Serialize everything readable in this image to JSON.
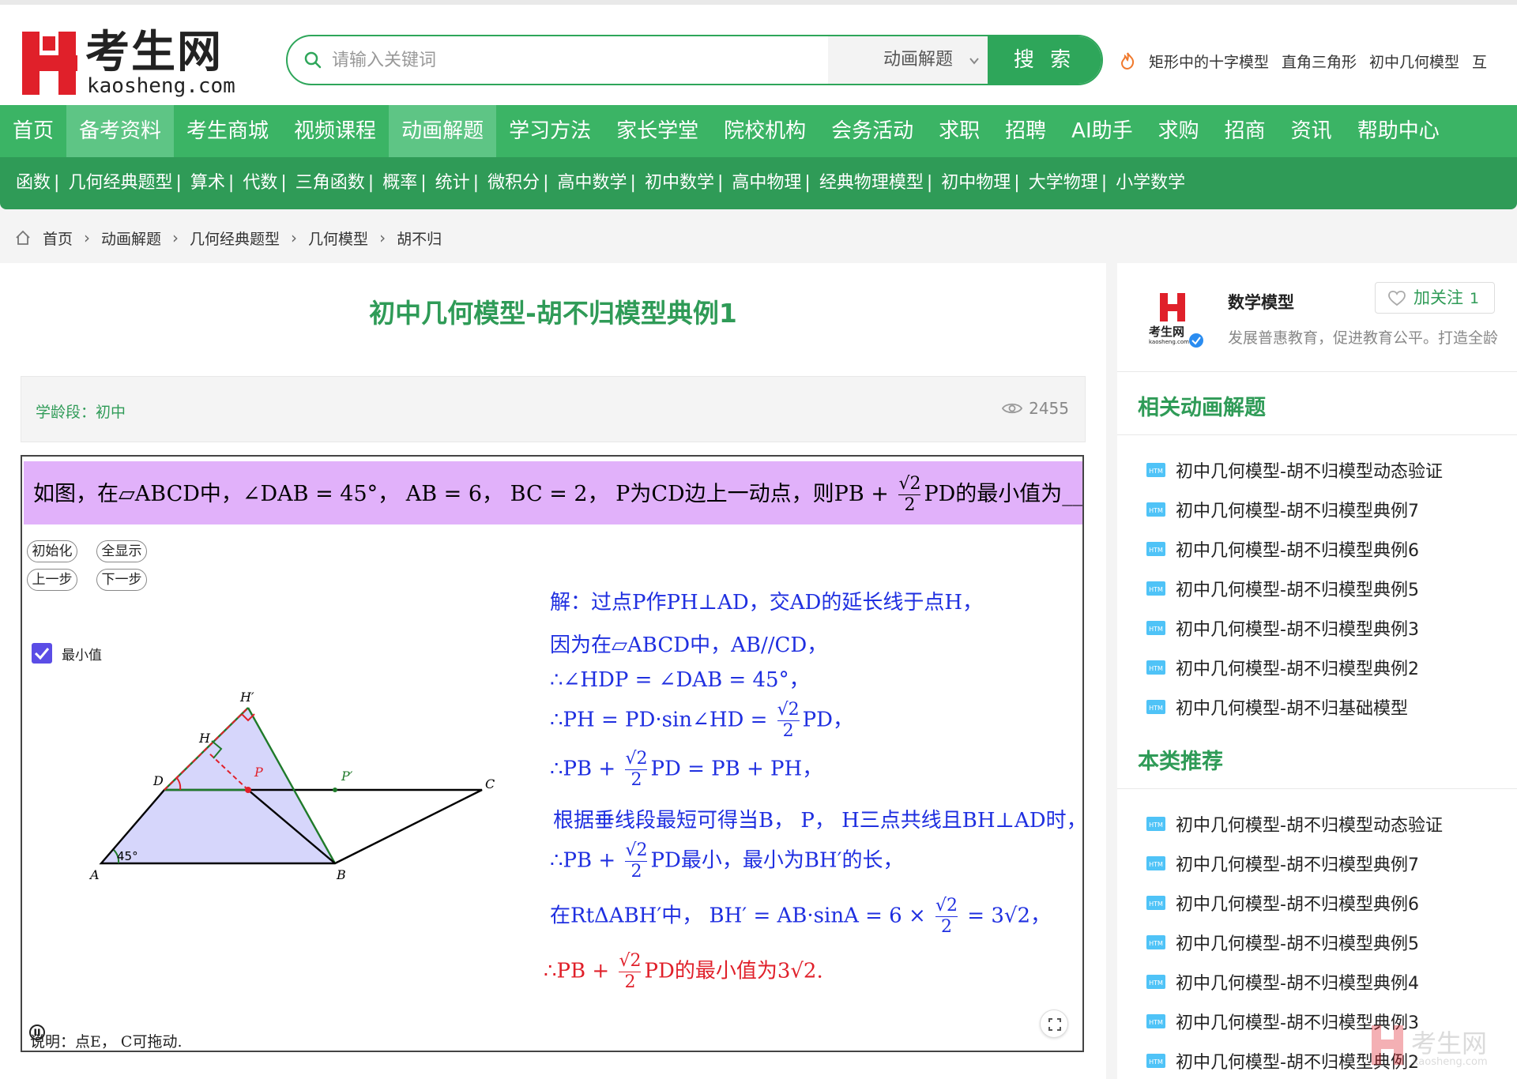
{
  "brand": {
    "cn": "考生网",
    "en": "kaosheng.com"
  },
  "search": {
    "placeholder": "请输入关键词",
    "category": "动画解题",
    "button": "搜 索"
  },
  "hot_keywords": [
    "矩形中的十字模型",
    "直角三角形",
    "初中几何模型",
    "互"
  ],
  "nav": [
    {
      "label": "首页",
      "active": false
    },
    {
      "label": "备考资料",
      "active": true
    },
    {
      "label": "考生商城",
      "active": false
    },
    {
      "label": "视频课程",
      "active": false
    },
    {
      "label": "动画解题",
      "active": true
    },
    {
      "label": "学习方法",
      "active": false
    },
    {
      "label": "家长学堂",
      "active": false
    },
    {
      "label": "院校机构",
      "active": false
    },
    {
      "label": "会务活动",
      "active": false
    },
    {
      "label": "求职",
      "active": false
    },
    {
      "label": "招聘",
      "active": false
    },
    {
      "label": "AI助手",
      "active": false
    },
    {
      "label": "求购",
      "active": false
    },
    {
      "label": "招商",
      "active": false
    },
    {
      "label": "资讯",
      "active": false
    },
    {
      "label": "帮助中心",
      "active": false
    }
  ],
  "subnav": [
    "函数",
    "几何经典题型",
    "算术",
    "代数",
    "三角函数",
    "概率",
    "统计",
    "微积分",
    "高中数学",
    "初中数学",
    "高中物理",
    "经典物理模型",
    "初中物理",
    "大学物理",
    "小学数学"
  ],
  "breadcrumb": [
    "首页",
    "动画解题",
    "几何经典题型",
    "几何模型",
    "胡不归"
  ],
  "article": {
    "title": "初中几何模型-胡不归模型典例1",
    "level": "学龄段：初中",
    "views": "2455"
  },
  "applet": {
    "question": "如图，在▱ABCD中，∠DAB = 45°， AB = 6， BC = 2， P为CD边上一动点，则PB + ",
    "question_tail": "PD的最小值为______",
    "buttons": {
      "init": "初始化",
      "show_all": "全显示",
      "prev": "上一步",
      "next": "下一步"
    },
    "checkbox_label": "最小值",
    "note": "说明：点E， C可拖动.",
    "points": {
      "A": "A",
      "B": "B",
      "C": "C",
      "D": "D",
      "P": "P",
      "P2": "P′",
      "H": "H",
      "H2": "H′",
      "angle": "45°"
    },
    "solution": [
      "解：过点P作PH⊥AD，交AD的延长线于点H，",
      "因为在▱ABCD中，AB//CD，",
      "∴∠HDP = ∠DAB = 45°，",
      "∴PH = PD·sin∠HD = ",
      "PD，",
      "∴PB + ",
      "PD = PB + PH，",
      "根据垂线段最短可得当B， P， H三点共线且BH⊥AD时，",
      "∴PB + ",
      "PD最小，最小为BH′的长，",
      "在RtΔABH′中， BH′ = AB·sinA = 6 × ",
      " = 3√2，",
      "∴PB + ",
      "PD的最小值为3√2."
    ],
    "frac_num": "√2",
    "frac_den": "2"
  },
  "author": {
    "name": "数学模型",
    "desc": "发展普惠教育，促进教育公平。打造全龄",
    "follow": "加关注",
    "follow_count": "1"
  },
  "related": {
    "title": "相关动画解题",
    "items": [
      "初中几何模型-胡不归模型动态验证",
      "初中几何模型-胡不归模型典例7",
      "初中几何模型-胡不归模型典例6",
      "初中几何模型-胡不归模型典例5",
      "初中几何模型-胡不归模型典例3",
      "初中几何模型-胡不归模型典例2",
      "初中几何模型-胡不归基础模型"
    ]
  },
  "recommend": {
    "title": "本类推荐",
    "items": [
      "初中几何模型-胡不归模型动态验证",
      "初中几何模型-胡不归模型典例7",
      "初中几何模型-胡不归模型典例6",
      "初中几何模型-胡不归模型典例5",
      "初中几何模型-胡不归模型典例4",
      "初中几何模型-胡不归模型典例3",
      "初中几何模型-胡不归模型典例2"
    ]
  },
  "colors": {
    "green": "#3bb465",
    "dark_green": "#2f9b57",
    "question_bg": "#e1b1fa",
    "solution_blue": "#1f2fe0",
    "answer_red": "#e0202a"
  }
}
